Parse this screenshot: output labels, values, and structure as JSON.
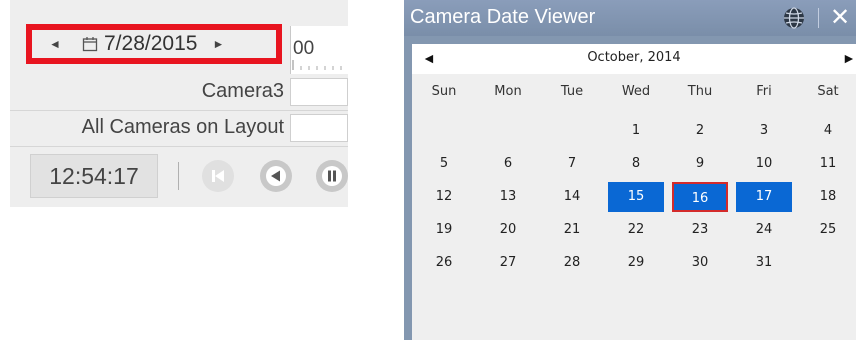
{
  "timeline": {
    "prev_label": "◄",
    "next_label": "►",
    "date": "7/28/2015",
    "scale_label": "00",
    "rows": [
      {
        "label": "Camera3"
      },
      {
        "label": "All Cameras on Layout"
      }
    ],
    "time": "12:54:17",
    "highlight_color": "#e8141f"
  },
  "viewer": {
    "title": "Camera Date Viewer",
    "close_label": "✕",
    "calendar": {
      "prev_label": "◄",
      "next_label": "►",
      "month": "October, 2014",
      "weekdays": [
        "Sun",
        "Mon",
        "Tue",
        "Wed",
        "Thu",
        "Fri",
        "Sat"
      ],
      "weeks": [
        [
          "",
          "",
          "",
          "1",
          "2",
          "3",
          "4"
        ],
        [
          "5",
          "6",
          "7",
          "8",
          "9",
          "10",
          "11"
        ],
        [
          "12",
          "13",
          "14",
          "15",
          "16",
          "17",
          "18"
        ],
        [
          "19",
          "20",
          "21",
          "22",
          "23",
          "24",
          "25"
        ],
        [
          "26",
          "27",
          "28",
          "29",
          "30",
          "31",
          ""
        ]
      ],
      "selected_days": [
        "15",
        "16",
        "17"
      ],
      "outlined_day": "16",
      "selected_color": "#0a68d4",
      "outline_color": "#d42b2b"
    }
  }
}
